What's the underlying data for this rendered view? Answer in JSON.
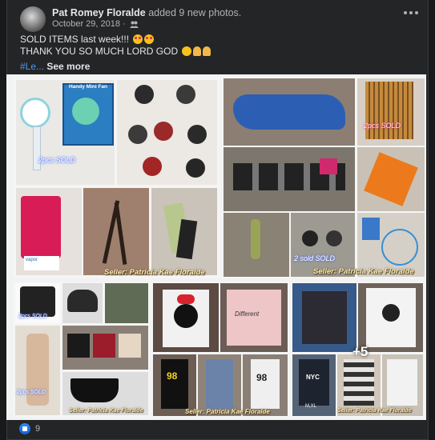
{
  "post": {
    "author": "Pat Romey Floralde",
    "action": "added 9 new photos.",
    "date": "October 29, 2018 ·",
    "audience_icon": "friends-icon",
    "line1": "SOLD ITEMS last week!!!",
    "line2": "THANK YOU SO MUCH LORD GOD",
    "hashtag": "#Le...",
    "see_more": "See more"
  },
  "photos": {
    "sold_1": "2pcs SOLD",
    "sold_2": "2pcs SOLD",
    "sold_3": "2 sold SOLD",
    "sold_4": "2pcs SOLD",
    "sold_5": "2pcs SOLD",
    "fan_box": "Handy Mini Fan",
    "vapor": "vapor",
    "shirt_text": "Different",
    "number": "98",
    "number2": "98",
    "nyc": "NYC",
    "size_text": "M,XL",
    "seller_1": "Seller: Patricia Kae Floralde",
    "seller_2": "Seller: Patricia Kae Floralde",
    "seller_3": "Seller: Patricia Kae Floralde",
    "seller_4": "Seller: Patricia Kae Floralde",
    "seller_5": "Seller: Patricia Kae Floralde",
    "more_count": "+5"
  },
  "reactions": {
    "icon": "like-icon",
    "count": "9"
  },
  "colors": {
    "background": "#18191a",
    "card": "#242526",
    "accent": "#2e89ff",
    "link": "#4599ff"
  }
}
